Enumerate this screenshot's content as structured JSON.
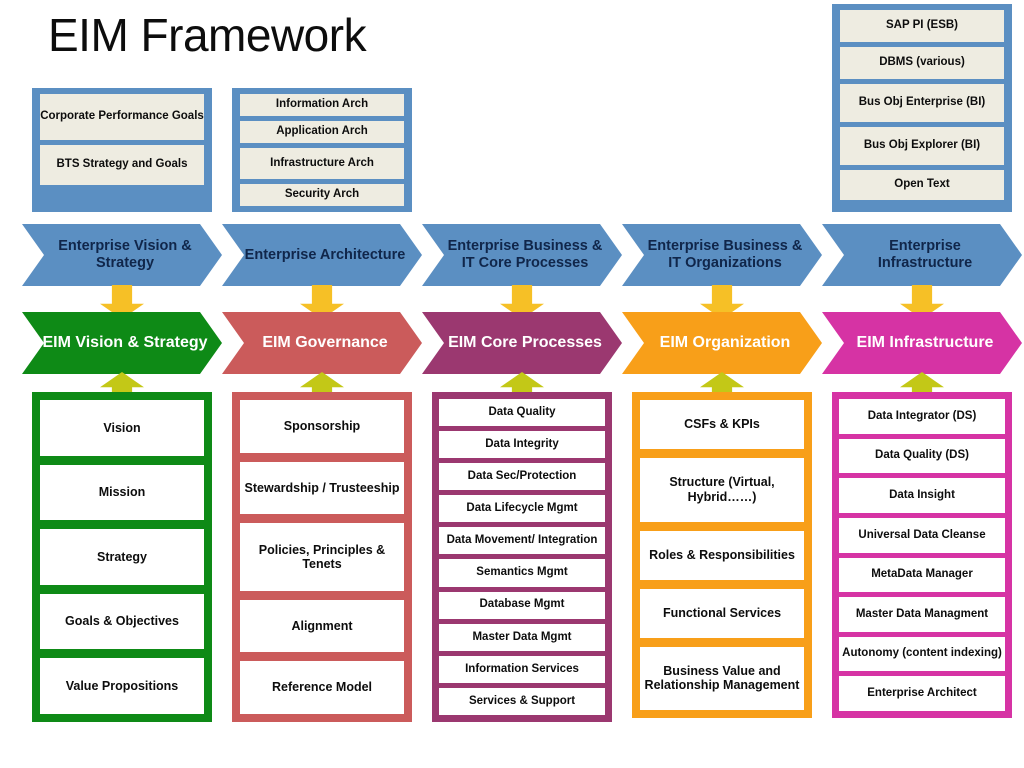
{
  "title": "EIM Framework",
  "colors": {
    "blue": "#5b8fc2",
    "chip": "#eeece1",
    "arrow_down": "#f6c026",
    "arrow_up": "#c3c817",
    "green": "#0e8a16",
    "red": "#cb5b5b",
    "purple": "#9b3870",
    "orange": "#f89f19",
    "magenta": "#d633a4"
  },
  "top_groups": [
    {
      "name": "corporate-goals-group",
      "items": [
        "Corporate Performance Goals",
        "BTS Strategy and Goals"
      ]
    },
    {
      "name": "architecture-group",
      "items": [
        "Information Arch",
        "Application Arch",
        "Infrastructure Arch",
        "Security Arch"
      ]
    },
    {
      "name": "infrastructure-tools-group",
      "items": [
        "SAP PI (ESB)",
        "DBMS (various)",
        "Bus Obj Enterprise (BI)",
        "Bus Obj Explorer (BI)",
        "Open Text"
      ]
    }
  ],
  "driver_row": [
    {
      "label": "Enterprise Vision & Strategy"
    },
    {
      "label": "Enterprise Architecture"
    },
    {
      "label": "Enterprise Business & IT Core Processes"
    },
    {
      "label": "Enterprise Business & IT Organizations"
    },
    {
      "label": "Enterprise Infrastructure"
    }
  ],
  "eim_row": [
    {
      "label": "EIM Vision & Strategy",
      "color": "#0e8a16"
    },
    {
      "label": "EIM Governance",
      "color": "#cb5b5b"
    },
    {
      "label": "EIM Core Processes",
      "color": "#9b3870"
    },
    {
      "label": "EIM Organization",
      "color": "#f89f19"
    },
    {
      "label": "EIM Infrastructure",
      "color": "#d633a4"
    }
  ],
  "columns": [
    {
      "name": "eim-vision-strategy-column",
      "color": "#0e8a16",
      "items": [
        "Vision",
        "Mission",
        "Strategy",
        "Goals & Objectives",
        "Value Propositions"
      ]
    },
    {
      "name": "eim-governance-column",
      "color": "#cb5b5b",
      "items": [
        "Sponsorship",
        "Stewardship / Trusteeship",
        "Policies, Principles & Tenets",
        "Alignment",
        "Reference Model"
      ]
    },
    {
      "name": "eim-core-processes-column",
      "color": "#9b3870",
      "items": [
        "Data Quality",
        "Data Integrity",
        "Data Sec/Protection",
        "Data Lifecycle Mgmt",
        "Data Movement/ Integration",
        "Semantics  Mgmt",
        "Database Mgmt",
        "Master Data Mgmt",
        "Information Services",
        "Services & Support"
      ]
    },
    {
      "name": "eim-organization-column",
      "color": "#f89f19",
      "items": [
        "CSFs & KPIs",
        "Structure (Virtual, Hybrid……)",
        "Roles & Responsibilities",
        "Functional Services",
        "Business Value and Relationship Management"
      ]
    },
    {
      "name": "eim-infrastructure-column",
      "color": "#d633a4",
      "items": [
        "Data Integrator (DS)",
        "Data Quality (DS)",
        "Data Insight",
        "Universal Data Cleanse",
        "MetaData Manager",
        "Master Data Managment",
        "Autonomy (content indexing)",
        "Enterprise Architect"
      ]
    }
  ]
}
